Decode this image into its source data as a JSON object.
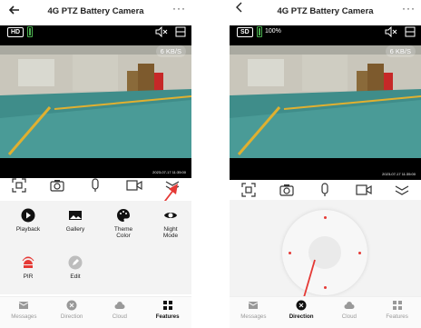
{
  "left": {
    "title": "4G PTZ Battery Camera",
    "more_label": "···",
    "video": {
      "quality_badge": "HD",
      "speed": "6 KB/S",
      "timestamp": "2023-07-17 11:35:00"
    },
    "features": [
      {
        "label": "Playback",
        "icon": "play-icon"
      },
      {
        "label": "Gallery",
        "icon": "image-icon"
      },
      {
        "label": "Theme\nColor",
        "icon": "palette-icon"
      },
      {
        "label": "Night\nMode",
        "icon": "eye-icon"
      },
      {
        "label": "PIR",
        "icon": "motion-sensor-icon"
      },
      {
        "label": "Edit",
        "icon": "pencil-icon"
      }
    ],
    "tabs": [
      {
        "label": "Messages",
        "icon": "mail-icon"
      },
      {
        "label": "Direction",
        "icon": "direction-icon"
      },
      {
        "label": "Cloud",
        "icon": "cloud-icon"
      },
      {
        "label": "Features",
        "icon": "grid-icon",
        "active": true
      }
    ]
  },
  "right": {
    "title": "4G PTZ Battery Camera",
    "more_label": "···",
    "video": {
      "quality_badge": "SD",
      "battery": "100%",
      "speed": "6 KB/S",
      "timestamp": "2023-07-17 11:35:00"
    },
    "tabs": [
      {
        "label": "Messages",
        "icon": "mail-icon"
      },
      {
        "label": "Direction",
        "icon": "direction-icon",
        "active": true
      },
      {
        "label": "Cloud",
        "icon": "cloud-icon"
      },
      {
        "label": "Features",
        "icon": "grid-icon"
      }
    ]
  },
  "colors": {
    "accent_red": "#e53935",
    "battery_green": "#4caf50",
    "feature_bg": "#f3f3f3"
  }
}
